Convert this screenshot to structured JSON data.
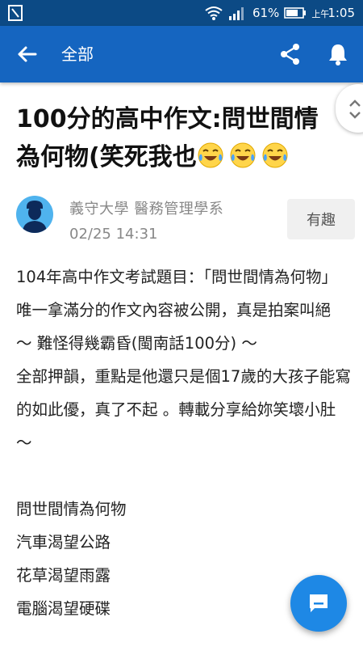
{
  "status_bar": {
    "battery_percent": "61%",
    "time_prefix": "上午",
    "time": "1:05"
  },
  "app_bar": {
    "title": "全部",
    "icons": [
      "back-arrow-icon",
      "share-icon",
      "bell-icon"
    ]
  },
  "post": {
    "title": "100分的高中作文:問世間情為何物(笑死我也",
    "title_emoji": [
      "face-with-tears-of-joy",
      "face-with-tears-of-joy",
      "face-with-tears-of-joy"
    ],
    "author": "義守大學 醫務管理學系",
    "date": "02/25 14:31",
    "follow_label": "有趣",
    "paragraphs": [
      "104年高中作文考試題目：「問世間情為何物」",
      "唯一拿滿分的作文內容被公開，真是拍案叫絕 ～ 難怪得幾霸昏(閩南話100分) ～",
      "全部押韻，重點是他還只是個17歲的大孩子能寫的如此優，真了不起 。轉載分享給妳笑壞小肚 ～"
    ],
    "lines": [
      "問世間情為何物",
      "汽車渴望公路",
      "花草渴望雨露",
      "電腦渴望硬碟"
    ]
  },
  "colors": {
    "status_bar": "#0c4a85",
    "app_bar": "#1565c0",
    "fab": "#1e88e5",
    "avatar": "#4fb3ee"
  }
}
